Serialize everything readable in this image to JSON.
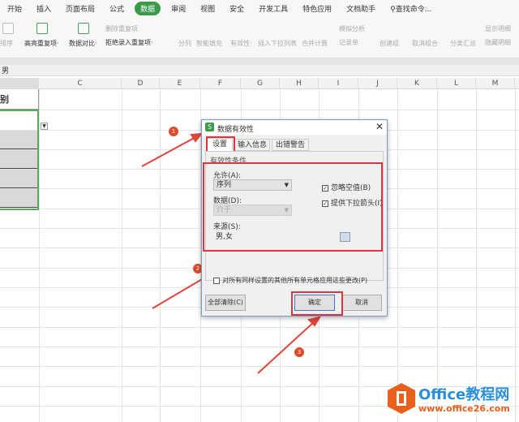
{
  "ribbon": {
    "tabs": [
      "开始",
      "插入",
      "页面布局",
      "公式",
      "数据",
      "审阅",
      "视图",
      "安全",
      "开发工具",
      "特色应用",
      "文档助手"
    ],
    "active_tab": "数据",
    "search": "查找命令...",
    "tools": [
      "排序",
      "高亮重复项·",
      "数据对比·",
      "删除重复项",
      "拒绝录入重复项·",
      "分列",
      "智能填充",
      "有效性·",
      "插入下拉列表",
      "合并计算",
      "模拟分析",
      "记录单",
      "创建组",
      "取消组合·",
      "分类汇总",
      "显示明细",
      "隐藏明细"
    ]
  },
  "formula_bar": {
    "value": "男"
  },
  "columns": [
    "C",
    "D",
    "E",
    "F",
    "G",
    "H",
    "I",
    "J",
    "K",
    "L",
    "M"
  ],
  "sheet": {
    "header_cell": "别"
  },
  "dialog": {
    "title": "数据有效性",
    "tabs": [
      "设置",
      "输入信息",
      "出错警告"
    ],
    "group_label": "有效性条件",
    "allow_label": "允许(A):",
    "allow_value": "序列",
    "data_label": "数据(D):",
    "data_value": "介于",
    "source_label": "来源(S):",
    "source_value": "男,女",
    "ignore_blank": "忽略空值(B)",
    "dropdown": "提供下拉箭头(I)",
    "apply_all": "对所有同样设置的其他所有单元格应用这些更改(P)",
    "clear_all": "全部清除(C)",
    "ok": "确定",
    "cancel": "取消"
  },
  "annotations": {
    "steps": [
      "1",
      "2",
      "3"
    ],
    "color": "#d9363e"
  },
  "watermark": {
    "brand": "Office教程网",
    "url": "www.office26.com"
  }
}
